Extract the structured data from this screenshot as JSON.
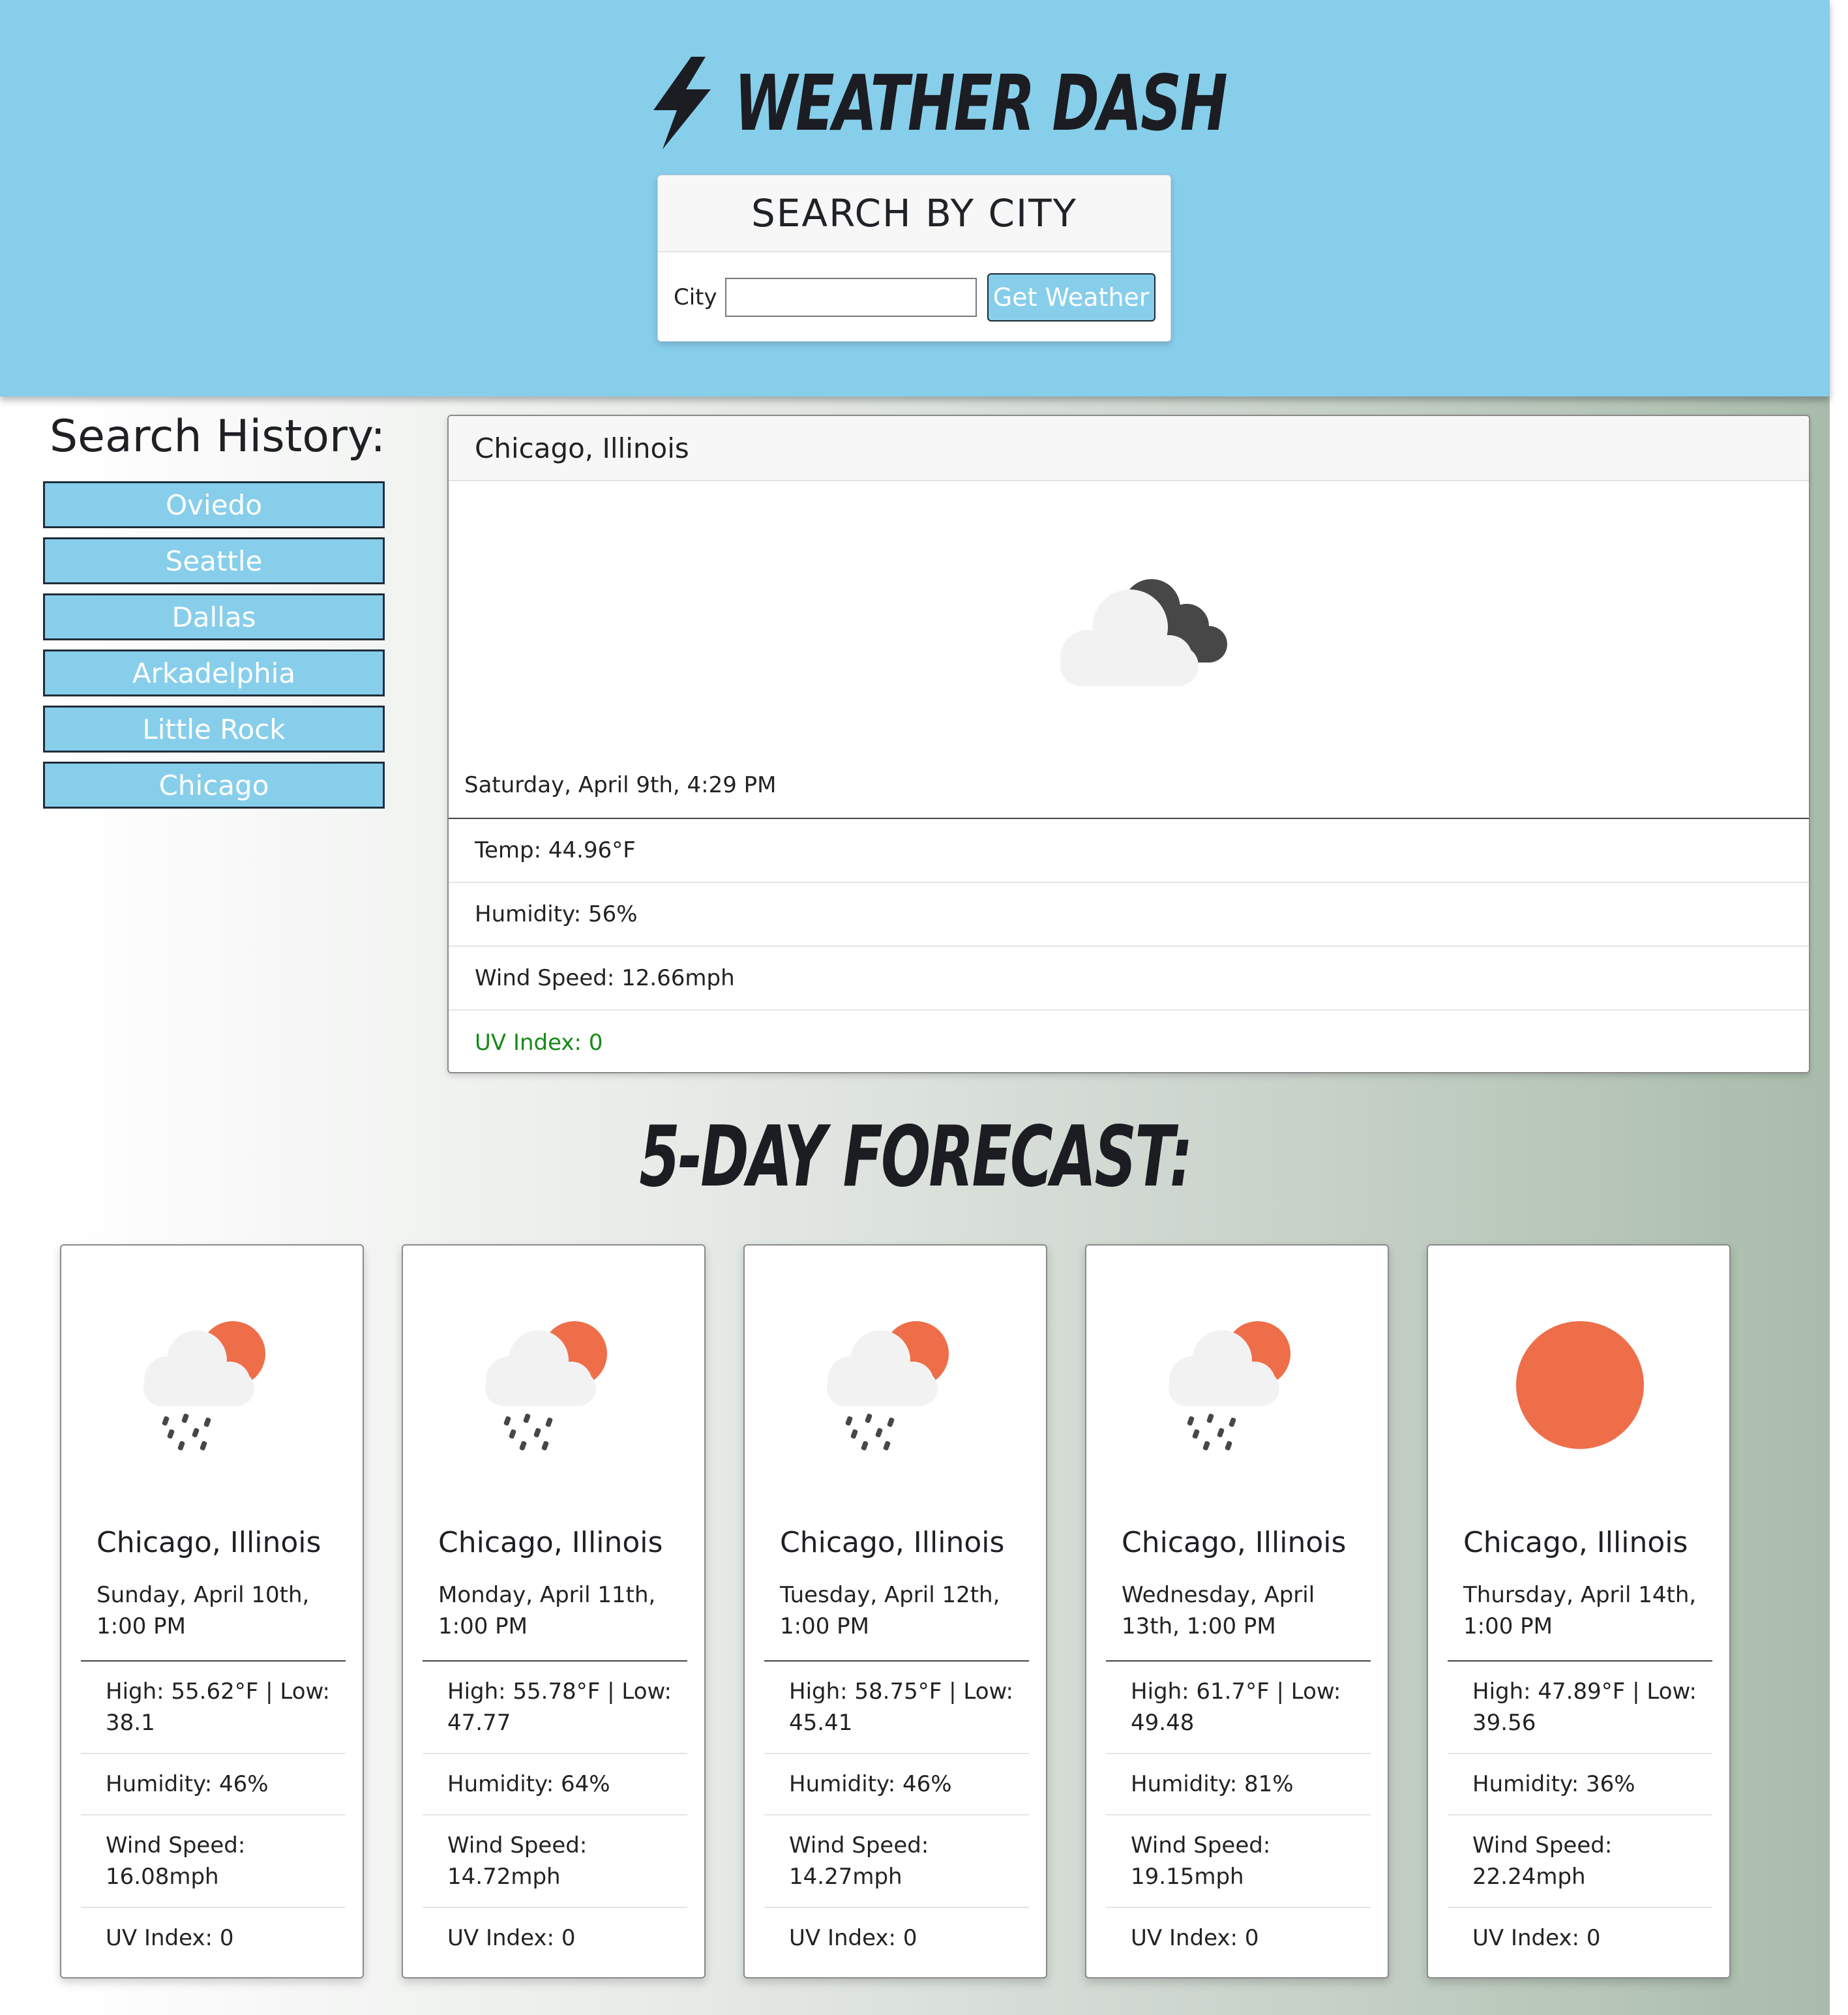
{
  "header": {
    "title": "Weather Dash",
    "search_card_title": "SEARCH BY CITY",
    "city_label": "City",
    "city_input_value": "",
    "city_input_placeholder": "",
    "submit_label": "Get Weather"
  },
  "history": {
    "title": "Search History:",
    "items": [
      "Oviedo",
      "Seattle",
      "Dallas",
      "Arkadelphia",
      "Little Rock",
      "Chicago"
    ]
  },
  "current": {
    "location": "Chicago, Illinois",
    "icon": "cloudy-dark-cloud-icon",
    "date": "Saturday, April 9th, 4:29 PM",
    "temp": "Temp: 44.96°F",
    "humidity": "Humidity: 56%",
    "wind": "Wind Speed: 12.66mph",
    "uv": "UV Index: 0"
  },
  "forecast": {
    "title": "5-Day Forecast:",
    "days": [
      {
        "location": "Chicago, Illinois",
        "icon": "rain-sun-icon",
        "date": "Sunday, April 10th, 1:00 PM",
        "highlow": "High: 55.62°F | Low: 38.1",
        "humidity": "Humidity: 46%",
        "wind": "Wind Speed: 16.08mph",
        "uv": "UV Index: 0"
      },
      {
        "location": "Chicago, Illinois",
        "icon": "rain-sun-icon",
        "date": "Monday, April 11th, 1:00 PM",
        "highlow": "High: 55.78°F | Low: 47.77",
        "humidity": "Humidity: 64%",
        "wind": "Wind Speed: 14.72mph",
        "uv": "UV Index: 0"
      },
      {
        "location": "Chicago, Illinois",
        "icon": "rain-sun-icon",
        "date": "Tuesday, April 12th, 1:00 PM",
        "highlow": "High: 58.75°F | Low: 45.41",
        "humidity": "Humidity: 46%",
        "wind": "Wind Speed: 14.27mph",
        "uv": "UV Index: 0"
      },
      {
        "location": "Chicago, Illinois",
        "icon": "rain-sun-icon",
        "date": "Wednesday, April 13th, 1:00 PM",
        "highlow": "High: 61.7°F | Low: 49.48",
        "humidity": "Humidity: 81%",
        "wind": "Wind Speed: 19.15mph",
        "uv": "UV Index: 0"
      },
      {
        "location": "Chicago, Illinois",
        "icon": "sun-icon",
        "date": "Thursday, April 14th, 1:00 PM",
        "highlow": "High: 47.89°F | Low: 39.56",
        "humidity": "Humidity: 36%",
        "wind": "Wind Speed: 22.24mph",
        "uv": "UV Index: 0"
      }
    ]
  },
  "colors": {
    "header_bg": "#87ceeb",
    "button_bg": "#87ceeb",
    "uv_text": "#168a16",
    "sun": "#ee6e4a",
    "cloud": "#f2f2f2",
    "dark_cloud": "#474747"
  }
}
